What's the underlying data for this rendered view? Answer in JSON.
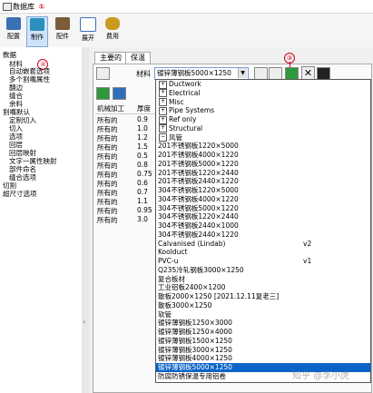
{
  "window": {
    "title": "数据库",
    "marker1": "①"
  },
  "toolbar": {
    "items": [
      {
        "label": "配置",
        "color": "#3b6fb6"
      },
      {
        "label": "制作",
        "color": "#2a8fbd"
      },
      {
        "label": "配件",
        "color": "#7a5c3a"
      },
      {
        "label": "展开",
        "color": "#3b6fb6"
      },
      {
        "label": "费用",
        "color": "#c89a1e"
      }
    ]
  },
  "sidebar": {
    "marker2": "②",
    "items": [
      {
        "label": "数据",
        "indent": 0
      },
      {
        "label": "材料",
        "indent": 1
      },
      {
        "label": "自动嵌套选项",
        "indent": 1
      },
      {
        "label": "多个割嘴属性",
        "indent": 1
      },
      {
        "label": "翻边",
        "indent": 1
      },
      {
        "label": "缝合",
        "indent": 1
      },
      {
        "label": "余料",
        "indent": 1
      },
      {
        "label": "割嘴默认",
        "indent": 0
      },
      {
        "label": "定制切入",
        "indent": 1
      },
      {
        "label": "切入",
        "indent": 1
      },
      {
        "label": "选项",
        "indent": 1
      },
      {
        "label": "回层",
        "indent": 1
      },
      {
        "label": "回层映射",
        "indent": 1
      },
      {
        "label": "文字一属性映射",
        "indent": 1
      },
      {
        "label": "部件命名",
        "indent": 1
      },
      {
        "label": "缝合选项",
        "indent": 1
      },
      {
        "label": "切割",
        "indent": 0
      },
      {
        "label": "超尺寸选项",
        "indent": 0
      }
    ]
  },
  "splitter": {
    "arrow": "‹"
  },
  "tabs": [
    {
      "label": "主要的",
      "active": true
    },
    {
      "label": "保温",
      "active": false
    }
  ],
  "material": {
    "label": "材料",
    "selected": "镀锌薄钢板5000×1250",
    "marker3": "③"
  },
  "grid": {
    "headers": [
      "机械加工",
      "厚度"
    ],
    "rows": [
      [
        "所有的",
        "0.9"
      ],
      [
        "所有的",
        "1.0"
      ],
      [
        "所有的",
        "1.2"
      ],
      [
        "所有的",
        "1.5"
      ],
      [
        "所有的",
        "0.5"
      ],
      [
        "所有的",
        "0.8"
      ],
      [
        "所有的",
        "0.75"
      ],
      [
        "所有的",
        "0.6"
      ],
      [
        "所有的",
        "0.7"
      ],
      [
        "所有的",
        "1.1"
      ],
      [
        "所有的",
        "0.95"
      ],
      [
        "所有的",
        "3.0"
      ]
    ],
    "edge_digits": [
      "5",
      "5",
      "5",
      "5",
      "5",
      "5",
      "5",
      "5",
      "5",
      "5",
      "5",
      "5",
      "5"
    ]
  },
  "dropdown": {
    "rows": [
      {
        "type": "group",
        "label": "Ductwork",
        "sign": "+"
      },
      {
        "type": "group",
        "label": "Electrical",
        "sign": "+"
      },
      {
        "type": "group",
        "label": "Misc",
        "sign": "+"
      },
      {
        "type": "group",
        "label": "Pipe Systems",
        "sign": "+"
      },
      {
        "type": "group",
        "label": "Ref only",
        "sign": "+"
      },
      {
        "type": "group",
        "label": "Structural",
        "sign": "+"
      },
      {
        "type": "group",
        "label": "风管",
        "sign": "−"
      },
      {
        "type": "item",
        "label": "201不锈钢板1220×5000"
      },
      {
        "type": "item",
        "label": "201不锈钢板4000×1220"
      },
      {
        "type": "item",
        "label": "201不锈钢板5000×1220"
      },
      {
        "type": "item",
        "label": "201不锈钢板1220×2440"
      },
      {
        "type": "item",
        "label": "201不锈钢板2440×1220"
      },
      {
        "type": "item",
        "label": "304不锈钢板1220×5000"
      },
      {
        "type": "item",
        "label": "304不锈钢板4000×1220"
      },
      {
        "type": "item",
        "label": "304不锈钢板5000×1220"
      },
      {
        "type": "item",
        "label": "304不锈钢板1220×2440"
      },
      {
        "type": "item",
        "label": "304不锈钢板2440×1000"
      },
      {
        "type": "item",
        "label": "304不锈钢板2440×1220"
      },
      {
        "type": "item",
        "label": "Calvanised (Lindab)",
        "suffix": "v2"
      },
      {
        "type": "item",
        "label": "Koolduct"
      },
      {
        "type": "item",
        "label": "PVC-u",
        "suffix": "v1"
      },
      {
        "type": "item",
        "label": "Q235冷轧钢板3000×1250"
      },
      {
        "type": "item",
        "label": "复合板材"
      },
      {
        "type": "item",
        "label": "工业铝板2400×1200"
      },
      {
        "type": "item",
        "label": "散板2000×1250 [2021.12.11复老三]"
      },
      {
        "type": "item",
        "label": "散板3000×1250"
      },
      {
        "type": "item",
        "label": "软管"
      },
      {
        "type": "item",
        "label": "镀锌薄钢板1250×3000"
      },
      {
        "type": "item",
        "label": "镀锌薄钢板1250×4000"
      },
      {
        "type": "item",
        "label": "镀锌薄钢板1500×1250"
      },
      {
        "type": "item",
        "label": "镀锌薄钢板3000×1250"
      },
      {
        "type": "item",
        "label": "镀锌薄钢板4000×1250"
      },
      {
        "type": "item",
        "label": "镀锌薄钢板5000×1250",
        "selected": true
      },
      {
        "type": "item",
        "label": "防腐防锈保温专用铝卷"
      }
    ]
  },
  "watermark": "知乎 @李小虎"
}
